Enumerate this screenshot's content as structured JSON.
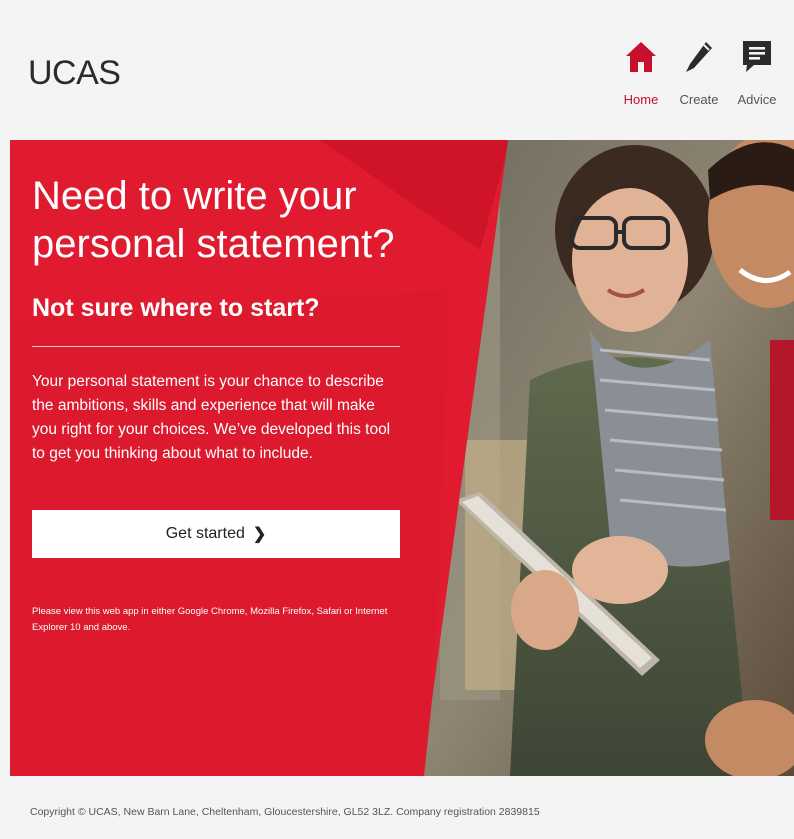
{
  "header": {
    "logo": "UCAS",
    "nav": [
      {
        "label": "Home",
        "icon": "home-icon",
        "active": true
      },
      {
        "label": "Create",
        "icon": "pencil-icon",
        "active": false
      },
      {
        "label": "Advice",
        "icon": "speech-bubble-icon",
        "active": false
      }
    ]
  },
  "hero": {
    "title": "Need to write your personal statement?",
    "subtitle": "Not sure where to start?",
    "description": "Your personal statement is your chance to describe the ambitions, skills and experience that will make you right for your choices. We’ve developed this tool to get you thinking about what to include.",
    "cta_label": "Get started",
    "cta_icon": "chevron-right-icon",
    "browser_note": "Please view this web app in either Google Chrome, Mozilla Firefox, Safari or Internet Explorer 10 and above."
  },
  "footer": {
    "copyright": "Copyright © UCAS, New Barn Lane, Cheltenham, Gloucestershire, GL52 3LZ. Company registration 2839815"
  },
  "colors": {
    "brand_red": "#e01b2f",
    "active_red": "#c8102e",
    "icon_dark": "#2b2b2b",
    "background": "#f4f4f4"
  }
}
